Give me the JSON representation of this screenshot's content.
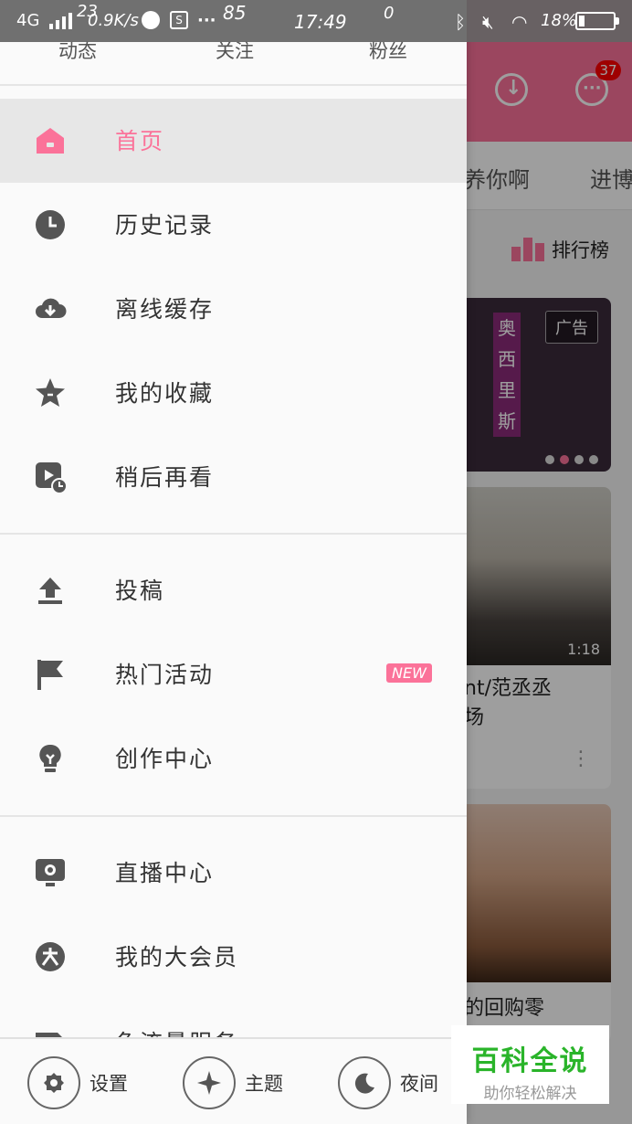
{
  "status_bar": {
    "network": "4G",
    "speed": "0.9K/s",
    "handwriting_1": "23",
    "handwriting_2": "85",
    "time": "17:49",
    "handwriting_3": "0",
    "battery_percent": "18%",
    "battery_level": 0.18
  },
  "background": {
    "badge_count": "37",
    "tabs": [
      "养你啊",
      "进博"
    ],
    "rank_label": "排行榜",
    "ad_label": "广告",
    "banner_vertical_text": "奥西里斯",
    "card2_duration": "1:18",
    "card2_title_line1": "nt/范丞丞",
    "card2_title_line2": "场",
    "card3_title": "的回购零"
  },
  "drawer": {
    "stats": {
      "dynamic": "动态",
      "follow": "关注",
      "fans": "粉丝"
    },
    "menu_group_1": [
      {
        "label": "首页",
        "icon": "home-icon",
        "active": true
      },
      {
        "label": "历史记录",
        "icon": "clock-icon",
        "active": false
      },
      {
        "label": "离线缓存",
        "icon": "cloud-download-icon",
        "active": false
      },
      {
        "label": "我的收藏",
        "icon": "star-icon",
        "active": false
      },
      {
        "label": "稍后再看",
        "icon": "watch-later-icon",
        "active": false
      }
    ],
    "menu_group_2": [
      {
        "label": "投稿",
        "icon": "upload-icon"
      },
      {
        "label": "热门活动",
        "icon": "flag-icon",
        "badge": "NEW"
      },
      {
        "label": "创作中心",
        "icon": "bulb-icon"
      }
    ],
    "menu_group_3": [
      {
        "label": "直播中心",
        "icon": "live-icon"
      },
      {
        "label": "我的大会员",
        "icon": "vip-icon"
      },
      {
        "label": "免流量服务",
        "icon": "card-icon"
      }
    ],
    "bottom_bar": {
      "settings": "设置",
      "theme": "主题",
      "night": "夜间"
    }
  },
  "watermark": {
    "title": "百科全说",
    "subtitle": "助你轻松解决"
  },
  "colors": {
    "accent": "#fb7299",
    "icon": "#555555",
    "text": "#333333"
  }
}
